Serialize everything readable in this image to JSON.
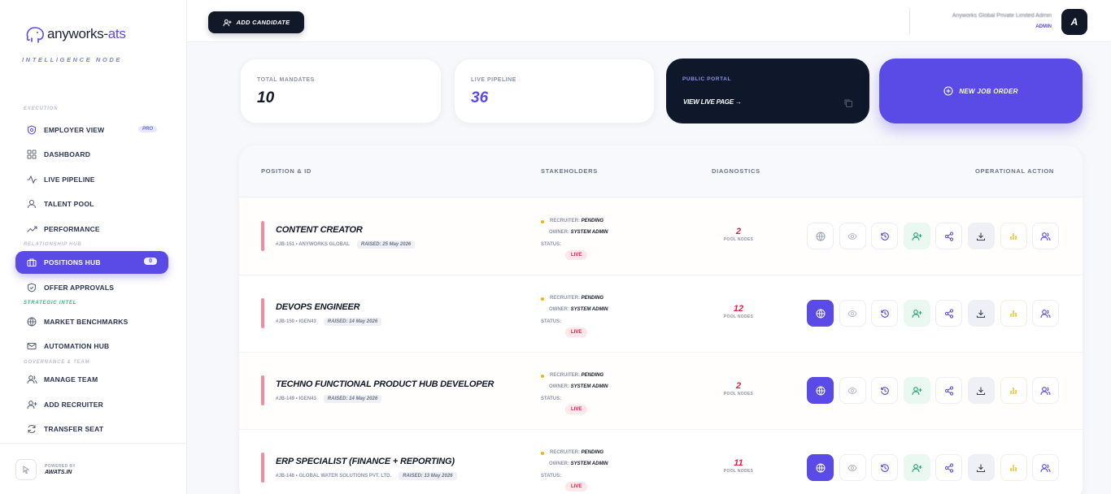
{
  "brand": {
    "name_main": "anyworks-",
    "name_accent": "ats",
    "tagline": "INTELLIGENCE NODE"
  },
  "sidebar": {
    "sections": {
      "execution": "EXECUTION",
      "relationship": "RELATIONSHIP HUB",
      "strategic": "STRATEGIC INTEL",
      "governance": "GOVERNANCE & TEAM"
    },
    "items": [
      {
        "label": "EMPLOYER VIEW",
        "badge": "PRO",
        "icon": "shield-icon"
      },
      {
        "label": "DASHBOARD",
        "icon": "grid-icon"
      },
      {
        "label": "LIVE PIPELINE",
        "icon": "pulse-icon"
      },
      {
        "label": "TALENT POOL",
        "icon": "user-icon"
      },
      {
        "label": "PERFORMANCE",
        "icon": "trend-icon"
      },
      {
        "label": "POSITIONS HUB",
        "badge": "0",
        "icon": "briefcase-icon"
      },
      {
        "label": "OFFER APPROVALS",
        "icon": "shield-check-icon"
      },
      {
        "label": "MARKET BENCHMARKS",
        "icon": "globe-icon"
      },
      {
        "label": "AUTOMATION HUB",
        "icon": "mail-icon"
      },
      {
        "label": "MANAGE TEAM",
        "icon": "users-icon"
      },
      {
        "label": "ADD RECRUITER",
        "icon": "user-plus-icon"
      },
      {
        "label": "TRANSFER SEAT",
        "icon": "refresh-icon"
      }
    ],
    "footer": {
      "powered": "POWERED BY",
      "brand": "AWATS.IN"
    }
  },
  "topbar": {
    "add_candidate": "ADD CANDIDATE",
    "user_name": "Anyworks Global Private Limited Admin",
    "user_role": "ADMIN",
    "avatar_letter": "A"
  },
  "stats": {
    "total_mandates_label": "TOTAL MANDATES",
    "total_mandates_value": "10",
    "live_pipeline_label": "LIVE PIPELINE",
    "live_pipeline_value": "36",
    "portal_label": "PUBLIC PORTAL",
    "portal_link": "VIEW LIVE PAGE →",
    "new_job": "NEW JOB ORDER"
  },
  "table": {
    "headers": {
      "position": "POSITION & ID",
      "stakeholders": "STAKEHOLDERS",
      "diagnostics": "DIAGNOSTICS",
      "action": "OPERATIONAL ACTION"
    },
    "labels": {
      "recruiter": "RECRUITER:",
      "owner": "OWNER:",
      "status": "STATUS:",
      "pool": "POOL NODES"
    },
    "rows": [
      {
        "title": "CONTENT CREATOR",
        "meta": "#JB-151 • ANYWORKS GLOBAL",
        "raised": "RAISED: 25 May 2026",
        "recruiter": "PENDING",
        "owner": "SYSTEM ADMIN",
        "status": "LIVE",
        "pool": "2"
      },
      {
        "title": "DEVOPS ENGINEER",
        "meta": "#JB-150 • IGEN43",
        "raised": "RAISED: 14 May 2026",
        "recruiter": "PENDING",
        "owner": "SYSTEM ADMIN",
        "status": "LIVE",
        "pool": "12"
      },
      {
        "title": "TECHNO FUNCTIONAL PRODUCT HUB DEVELOPER",
        "meta": "#JB-149 • IGEN43",
        "raised": "RAISED: 14 May 2026",
        "recruiter": "PENDING",
        "owner": "SYSTEM ADMIN",
        "status": "LIVE",
        "pool": "2"
      },
      {
        "title": "ERP SPECIALIST (FINANCE + REPORTING)",
        "meta": "#JB-148 • GLOBAL WATER SOLUTIONS PVT. LTD.",
        "raised": "RAISED: 13 May 2026",
        "recruiter": "PENDING",
        "owner": "SYSTEM ADMIN",
        "status": "LIVE",
        "pool": "11"
      }
    ]
  },
  "colors": {
    "accent": "#5b4be6",
    "dark": "#0f172a",
    "live": "#e11d48",
    "pending_dot": "#f5b300"
  }
}
